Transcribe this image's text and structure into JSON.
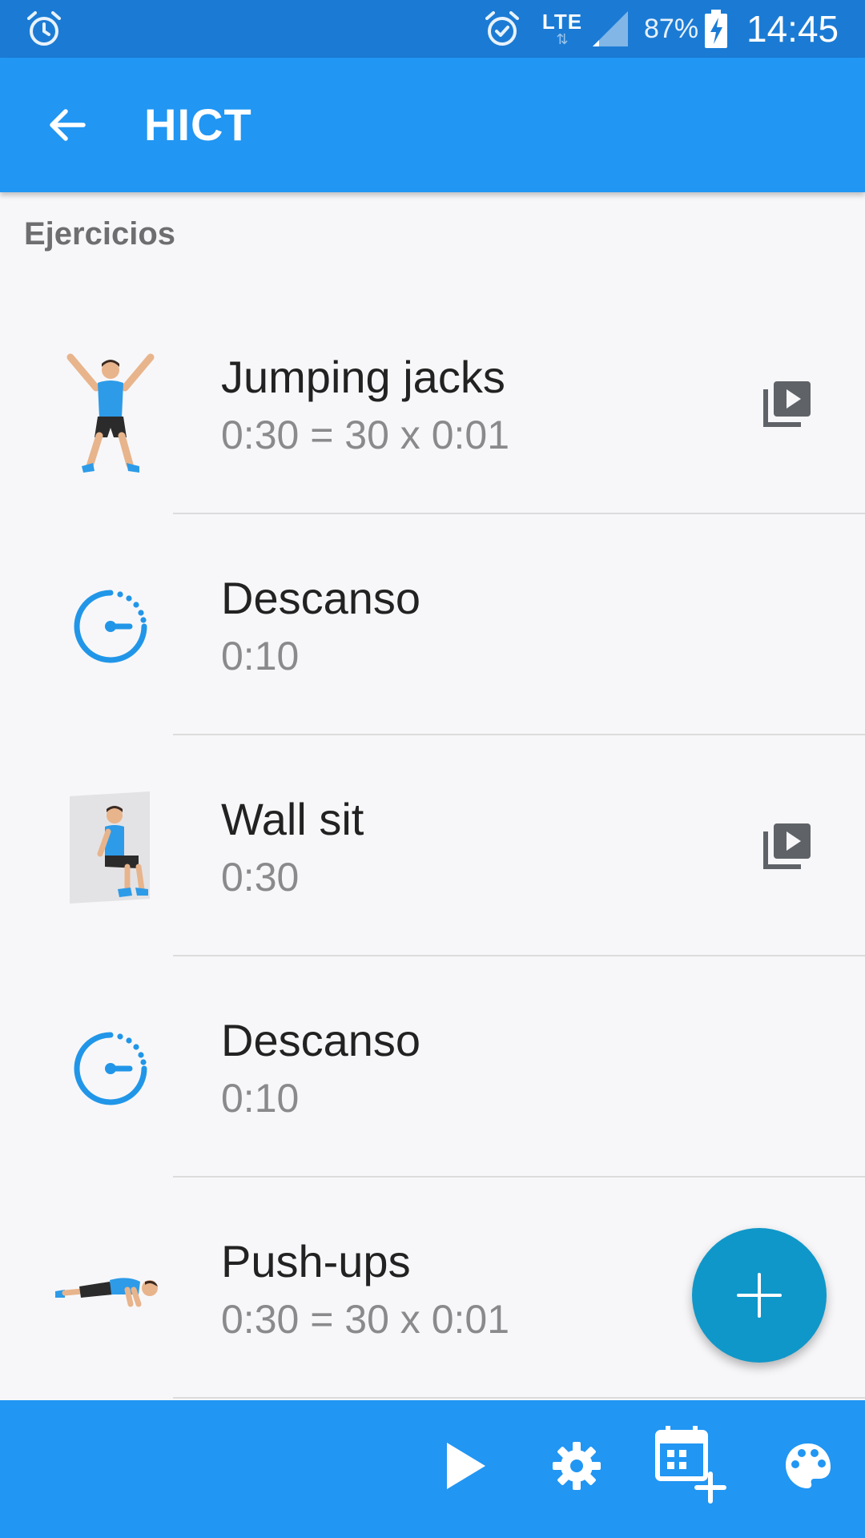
{
  "status_bar": {
    "battery_percent": "87%",
    "time": "14:45",
    "network": "LTE",
    "network_arrows": "⇅",
    "icons": [
      "alarm-icon",
      "alarm-check-icon",
      "signal-icon",
      "battery-charging-icon"
    ]
  },
  "app_bar": {
    "title": "HICT",
    "back_icon": "arrow-back-icon"
  },
  "section": {
    "title": "Ejercicios"
  },
  "exercises": [
    {
      "name": "Jumping jacks",
      "duration": "0:30 = 30 x 0:01",
      "thumb": "jumping-jacks-illustration",
      "has_video": true
    },
    {
      "name": "Descanso",
      "duration": "0:10",
      "thumb": "timer-icon",
      "has_video": false
    },
    {
      "name": "Wall sit",
      "duration": "0:30",
      "thumb": "wall-sit-illustration",
      "has_video": true
    },
    {
      "name": "Descanso",
      "duration": "0:10",
      "thumb": "timer-icon",
      "has_video": false
    },
    {
      "name": "Push-ups",
      "duration": "0:30 = 30 x 0:01",
      "thumb": "push-ups-illustration",
      "has_video": false
    }
  ],
  "fab": {
    "icon": "plus-icon"
  },
  "bottom_bar": {
    "icons": [
      "play-icon",
      "gear-icon",
      "calendar-add-icon",
      "palette-icon"
    ]
  },
  "colors": {
    "status_bar": "#1b7bd4",
    "primary": "#2196f3",
    "fab": "#0f97c9",
    "accent_blue": "#2196e8",
    "background": "#f7f7f9",
    "text_primary": "#222222",
    "text_secondary": "#8a8a8c"
  }
}
